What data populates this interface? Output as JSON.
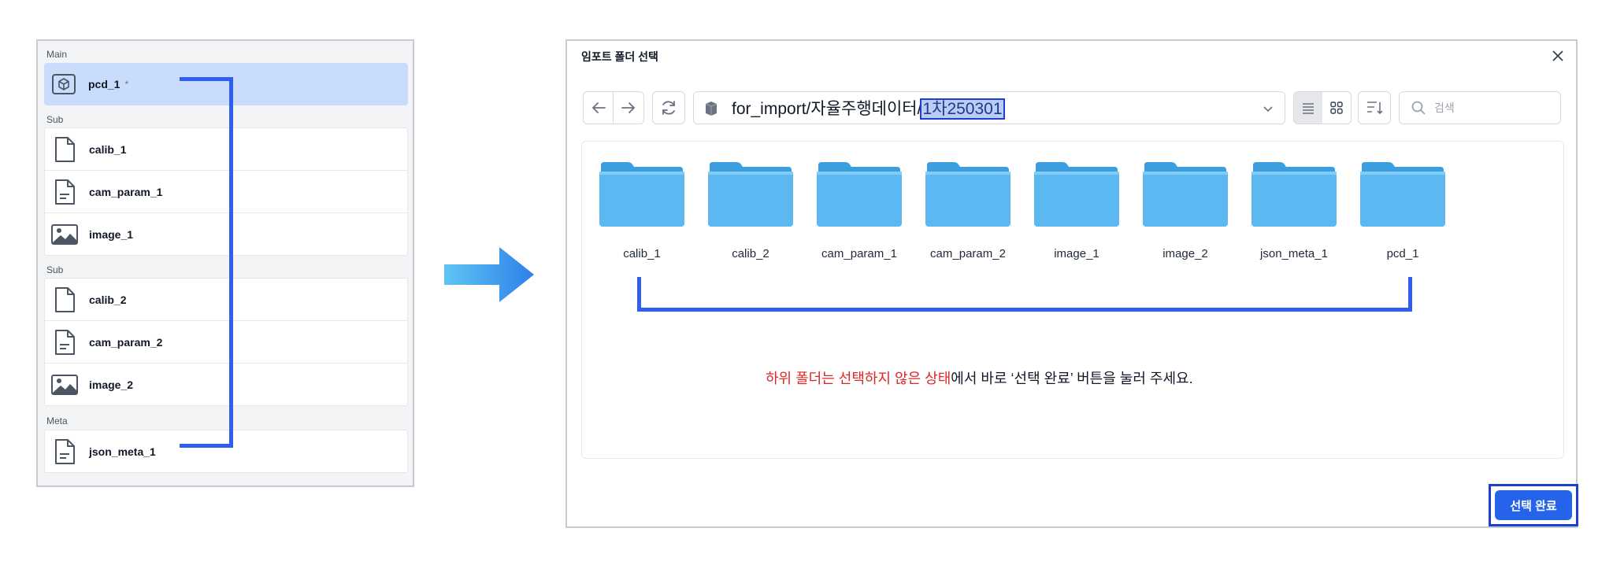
{
  "left_panel": {
    "main_label": "Main",
    "main_item": {
      "label": "pcd_1",
      "marker": "*",
      "icon": "cube-icon"
    },
    "sub1_label": "Sub",
    "sub1_items": [
      {
        "label": "calib_1",
        "icon": "file-icon"
      },
      {
        "label": "cam_param_1",
        "icon": "file-text-icon"
      },
      {
        "label": "image_1",
        "icon": "image-icon"
      }
    ],
    "sub2_label": "Sub",
    "sub2_items": [
      {
        "label": "calib_2",
        "icon": "file-icon"
      },
      {
        "label": "cam_param_2",
        "icon": "file-text-icon"
      },
      {
        "label": "image_2",
        "icon": "image-icon"
      }
    ],
    "meta_label": "Meta",
    "meta_items": [
      {
        "label": "json_meta_1",
        "icon": "file-text-icon"
      }
    ]
  },
  "dialog": {
    "title": "임포트 폴더 선택",
    "path_prefix": "for_import/자율주행데이터/",
    "path_selected": "1차250301",
    "search_placeholder": "검색",
    "folders": [
      "calib_1",
      "calib_2",
      "cam_param_1",
      "cam_param_2",
      "image_1",
      "image_2",
      "json_meta_1",
      "pcd_1"
    ],
    "note_red": "하위 폴더는 선택하지 않은 상태",
    "note_rest": "에서 바로 ‘선택 완료’ 버튼을 눌러 주세요.",
    "done_label": "선택 완료"
  },
  "colors": {
    "accent": "#2f5ef0",
    "button": "#2563eb",
    "note_red": "#dc2626",
    "selected_row": "#c9dcfb",
    "folder": "#5bb8f0"
  }
}
